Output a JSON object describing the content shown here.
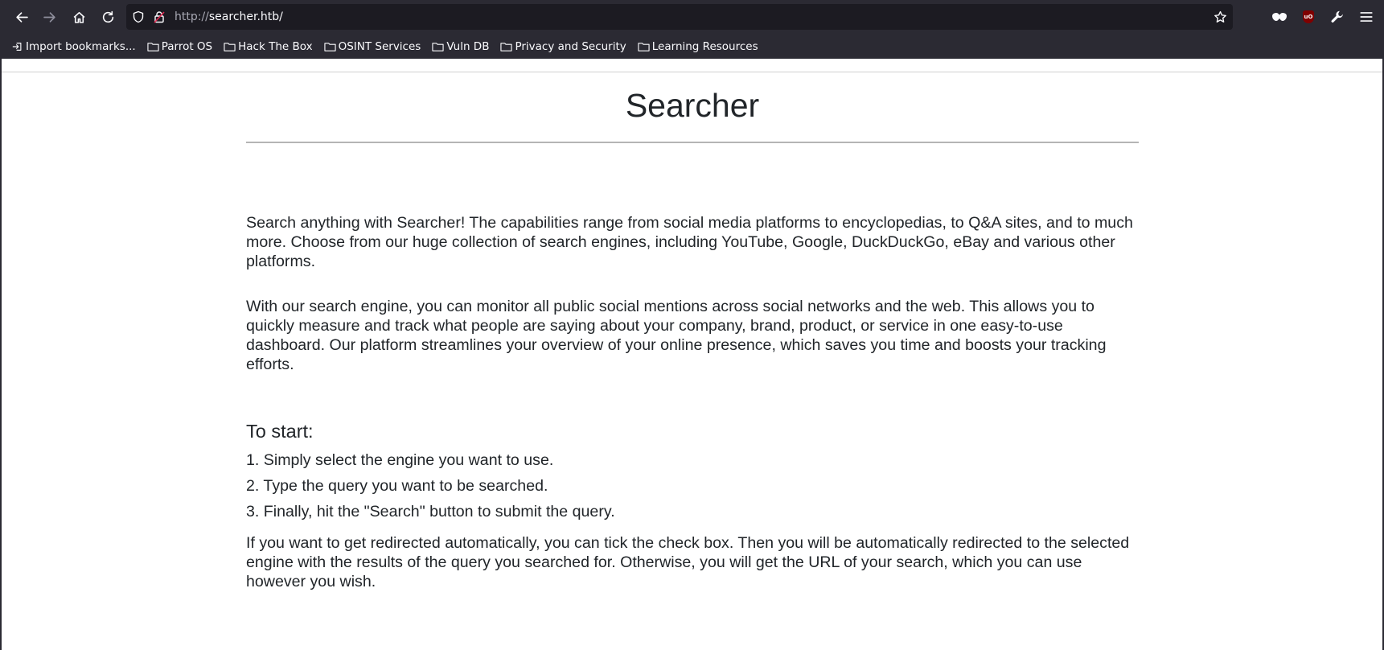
{
  "browser": {
    "url_scheme": "http://",
    "url_host": "searcher.htb/",
    "bookmarks": [
      {
        "label": "Import bookmarks...",
        "icon": "import-icon"
      },
      {
        "label": "Parrot OS",
        "icon": "folder-icon"
      },
      {
        "label": "Hack The Box",
        "icon": "folder-icon"
      },
      {
        "label": "OSINT Services",
        "icon": "folder-icon"
      },
      {
        "label": "Vuln DB",
        "icon": "folder-icon"
      },
      {
        "label": "Privacy and Security",
        "icon": "folder-icon"
      },
      {
        "label": "Learning Resources",
        "icon": "folder-icon"
      }
    ],
    "ublock_badge": "uO"
  },
  "page": {
    "title": "Searcher",
    "intro": "Search anything with Searcher! The capabilities range from social media platforms to encyclopedias, to Q&A sites, and to much more. Choose from our huge collection of search engines, including YouTube, Google, DuckDuckGo, eBay and various other platforms.",
    "monitor": "With our search engine, you can monitor all public social mentions across social networks and the web. This allows you to quickly measure and track what people are saying about your company, brand, product, or service in one easy-to-use dashboard. Our platform streamlines your overview of your online presence, which saves you time and boosts your tracking efforts.",
    "start_heading": "To start:",
    "steps": [
      "1. Simply select the engine you want to use.",
      "2. Type the query you want to be searched.",
      "3. Finally, hit the \"Search\" button to submit the query."
    ],
    "redirect_note": "If you want to get redirected automatically, you can tick the check box. Then you will be automatically redirected to the selected engine with the results of the query you searched for. Otherwise, you will get the URL of your search, which you can use however you wish."
  }
}
